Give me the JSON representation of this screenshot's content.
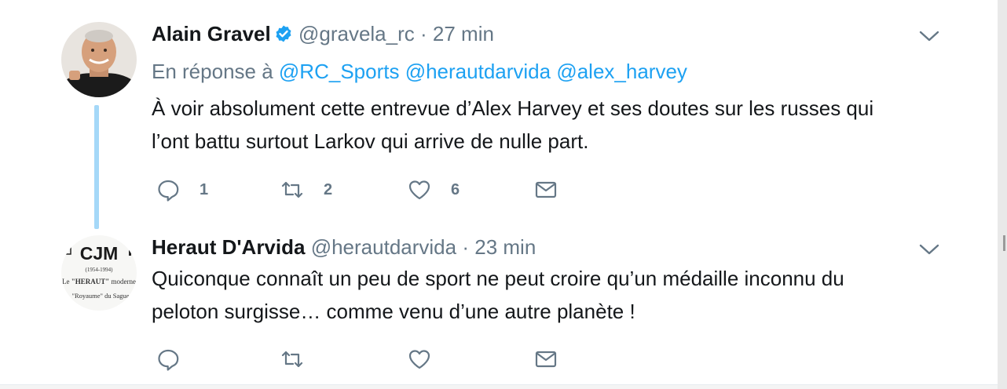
{
  "tweets": [
    {
      "author_name": "Alain Gravel",
      "verified": true,
      "handle": "@gravela_rc",
      "separator": "·",
      "time": "27 min",
      "reply_prefix": "En réponse à",
      "reply_mentions": [
        "@RC_Sports",
        "@herautdarvida",
        "@alex_harvey"
      ],
      "text_lines": [
        "À voir absolument cette entrevue d’Alex Harvey et ses doutes sur les russes qui",
        "l’ont battu surtout Larkov qui arrive de nulle part."
      ],
      "replies": "1",
      "retweets": "2",
      "likes": "6"
    },
    {
      "author_name": "Heraut D'Arvida",
      "handle": "@herautdarvida",
      "separator": "·",
      "time": "23 min",
      "text_lines": [
        "Quiconque connaît un peu de sport ne peut croire qu’un médaille inconnu du",
        "peloton surgisse… comme venu d’une autre planète !"
      ]
    }
  ],
  "avatar2_logo": {
    "call_sign": "CJM",
    "years": "(1954-1994)",
    "line1_prefix": "Le ",
    "line1_bold": "\"HERAUT\"",
    "line1_suffix": " moderne",
    "line2": "\"Royaume\" du Sague"
  },
  "colors": {
    "link": "#1da1f2",
    "secondary_text": "#657786",
    "thread_line": "#a5d8f8",
    "verified_badge": "#1da1f2"
  },
  "icons": [
    "reply-icon",
    "retweet-icon",
    "like-icon",
    "dm-icon",
    "chevron-down-icon",
    "verified-badge-icon"
  ]
}
